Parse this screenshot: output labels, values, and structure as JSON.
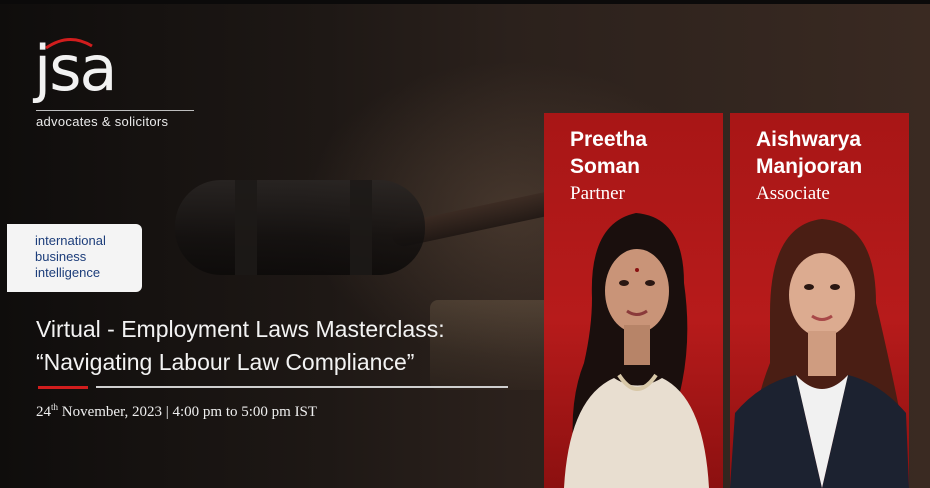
{
  "logo": {
    "mark": "jsa",
    "tagline": "advocates & solicitors",
    "accent": "#d11d1d"
  },
  "partner_logo": {
    "lines": [
      "international",
      "business",
      "intelligence"
    ],
    "color": "#1c3d7a"
  },
  "event": {
    "title_line1": "Virtual - Employment Laws Masterclass:",
    "title_line2": "“Navigating Labour Law Compliance”",
    "date_day": "24",
    "date_suffix": "th",
    "date_rest": " November, 2023 | 4:00 pm to 5:00 pm IST"
  },
  "speakers": [
    {
      "first": "Preetha",
      "last": "Soman",
      "role": "Partner"
    },
    {
      "first": "Aishwarya",
      "last": "Manjooran",
      "role": "Associate"
    }
  ],
  "colors": {
    "panel_red": "#b71b1b",
    "background": "#1a1512"
  }
}
